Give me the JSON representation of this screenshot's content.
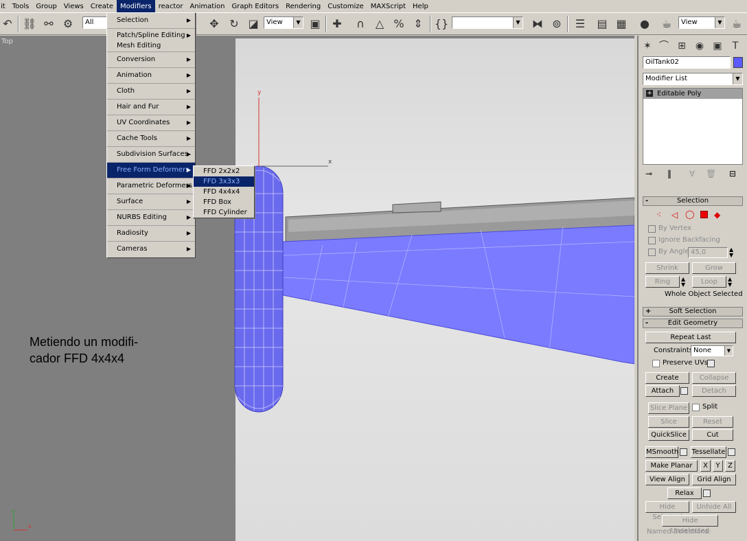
{
  "menubar": {
    "items": [
      "it",
      "Tools",
      "Group",
      "Views",
      "Create",
      "Modifiers",
      "reactor",
      "Animation",
      "Graph Editors",
      "Rendering",
      "Customize",
      "MAXScript",
      "Help"
    ],
    "active_index": 5
  },
  "toolbar": {
    "selection_filter": "All",
    "ref_coord_1": "View",
    "named_selection": "",
    "ref_coord_2": "View"
  },
  "viewport": {
    "label": "Top",
    "axis_y": "y",
    "axis_x": "x",
    "caption_line1": "Metiendo un modifi-",
    "caption_line2": "cador FFD 4x4x4",
    "mesh_color": "#7b7bff"
  },
  "modifiers_menu": {
    "items": [
      {
        "label": "Selection",
        "sub": true
      },
      {
        "label": "Patch/Spline Editing",
        "label2": "Mesh Editing",
        "sub": true
      },
      {
        "label": "Conversion",
        "sub": true
      },
      {
        "label": "Animation",
        "sub": true
      },
      {
        "label": "Cloth",
        "sub": true
      },
      {
        "label": "Hair and Fur",
        "sub": true
      },
      {
        "label": "UV Coordinates",
        "sub": true
      },
      {
        "label": "Cache Tools",
        "sub": true
      },
      {
        "label": "Subdivision Surfaces",
        "sub": true
      },
      {
        "label": "Free Form Deformers",
        "sub": true,
        "highlighted": true
      },
      {
        "label": "Parametric Deformers",
        "sub": true
      },
      {
        "label": "Surface",
        "sub": true
      },
      {
        "label": "NURBS Editing",
        "sub": true
      },
      {
        "label": "Radiosity",
        "sub": true
      },
      {
        "label": "Cameras",
        "sub": true
      }
    ]
  },
  "ffd_submenu": {
    "items": [
      "FFD 2x2x2",
      "FFD 3x3x3",
      "FFD 4x4x4",
      "FFD Box",
      "FFD Cylinder"
    ],
    "highlighted_index": 1
  },
  "panel": {
    "object_name": "OilTank02",
    "object_color": "#5a5aff",
    "modifier_list": "Modifier List",
    "stack_item": "Editable Poly",
    "selection": {
      "title": "Selection",
      "by_vertex": "By Vertex",
      "ignore_backfacing": "Ignore Backfacing",
      "by_angle": "By Angle:",
      "angle_value": "45,0",
      "shrink": "Shrink",
      "grow": "Grow",
      "ring": "Ring",
      "loop": "Loop",
      "status": "Whole Object Selected"
    },
    "soft_selection": {
      "title": "Soft Selection"
    },
    "edit_geometry": {
      "title": "Edit Geometry",
      "repeat_last": "Repeat Last",
      "constraints_label": "Constraints:",
      "constraints_value": "None",
      "preserve_uvs": "Preserve UVs",
      "create": "Create",
      "collapse": "Collapse",
      "attach": "Attach",
      "detach": "Detach",
      "slice_plane": "Slice Plane",
      "split": "Split",
      "slice": "Slice",
      "reset_plane": "Reset Plane",
      "quickslice": "QuickSlice",
      "cut": "Cut",
      "msmooth": "MSmooth",
      "tessellate": "Tessellate",
      "make_planar": "Make Planar",
      "x": "X",
      "y": "Y",
      "z": "Z",
      "view_align": "View Align",
      "grid_align": "Grid Align",
      "relax": "Relax",
      "hide_selected": "Hide Selected",
      "unhide_all": "Unhide All",
      "hide_unselected": "Hide Unselected",
      "named_selections": "Named Selections:"
    }
  }
}
